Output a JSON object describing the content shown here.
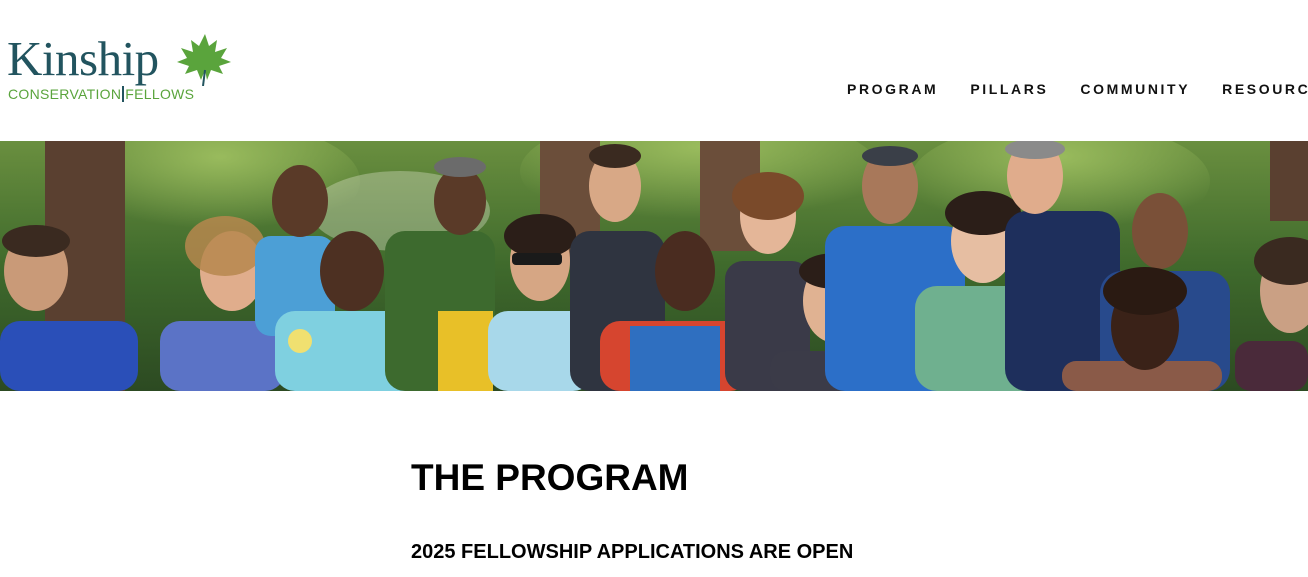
{
  "logo": {
    "word": "Kinship",
    "sub_left": "CONSERVATION",
    "sub_right": "FELLOWS",
    "colors": {
      "word": "#22545f",
      "sub": "#5aa43c",
      "leaf": "#5aa43c"
    },
    "icon": "maple-leaf-icon"
  },
  "nav": {
    "items": [
      {
        "label": "PROGRAM"
      },
      {
        "label": "PILLARS"
      },
      {
        "label": "COMMUNITY"
      },
      {
        "label": "RESOURCES"
      }
    ]
  },
  "hero": {
    "icon": "group-photo"
  },
  "main": {
    "title": "THE PROGRAM",
    "subtitle": "2025 FELLOWSHIP APPLICATIONS ARE OPEN"
  }
}
